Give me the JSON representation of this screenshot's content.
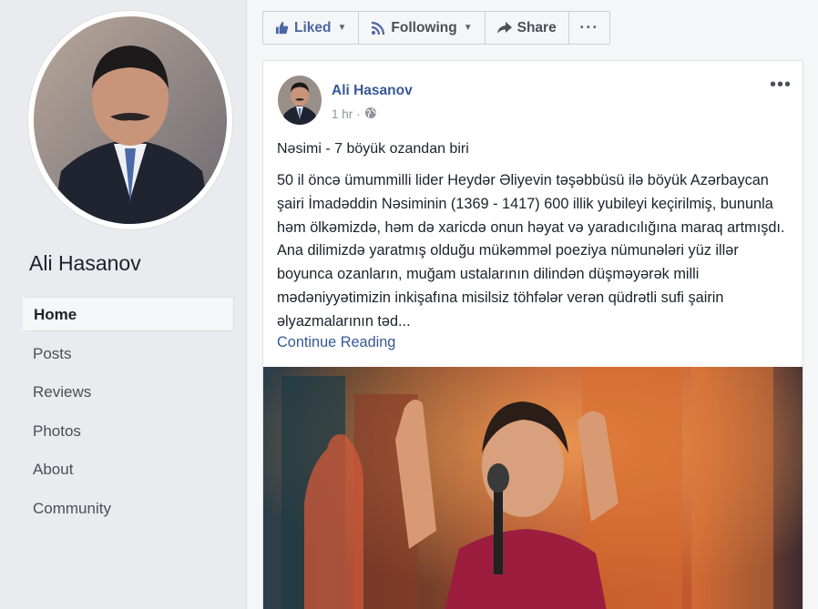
{
  "page": {
    "name": "Ali Hasanov"
  },
  "nav": {
    "items": [
      {
        "label": "Home",
        "active": true
      },
      {
        "label": "Posts"
      },
      {
        "label": "Reviews"
      },
      {
        "label": "Photos"
      },
      {
        "label": "About"
      },
      {
        "label": "Community"
      }
    ]
  },
  "actions": {
    "liked": "Liked",
    "following": "Following",
    "share": "Share",
    "more": "···"
  },
  "post": {
    "author": "Ali Hasanov",
    "time": "1 hr",
    "options": "•••",
    "title": "Nəsimi - 7 böyük ozandan biri",
    "body": "50 il öncə ümummilli lider Heydər Əliyevin təşəbbüsü ilə böyük Azərbaycan şairi İmadəddin Nəsiminin (1369 - 1417) 600 illik yubileyi keçirilmiş, bununla həm ölkəmizdə, həm də xaricdə onun həyat və yaradıcılığına maraq artmışdı. Ana dilimizdə yaratmış olduğu mükəmməl poeziya nümunələri yüz illər boyunca ozanların, muğam ustalarının dilindən düşməyərək milli mədəniyyətimizin inkişafına misilsiz töhfələr verən qüdrətli sufi şairin əlyazmalarının təd...",
    "continue": "Continue Reading"
  },
  "icons": {
    "liked": "thumbs-up-icon",
    "following": "rss-icon",
    "share": "share-arrow-icon",
    "audience": "globe-icon"
  },
  "colors": {
    "link": "#365899",
    "liked": "#4b67a1",
    "background": "#e9ebee"
  }
}
